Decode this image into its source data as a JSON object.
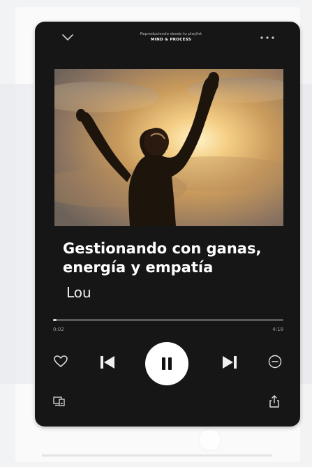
{
  "header": {
    "caption": "Reproduciendo desde tu playlist",
    "playlist": "MIND & PROCESS"
  },
  "track": {
    "title": "Gestionando con ganas, energía y empatía",
    "artist": "Lou"
  },
  "playback": {
    "elapsed": "0:02",
    "total": "4:18",
    "progress_fraction": 0.008,
    "state": "playing"
  },
  "icons": {
    "collapse": "chevron-down-icon",
    "menu": "more-icon",
    "like": "heart-icon",
    "previous": "skip-previous-icon",
    "play_state": "pause-icon",
    "next": "skip-next-icon",
    "hide": "minus-circle-icon",
    "devices": "devices-icon",
    "share": "share-icon"
  },
  "colors": {
    "player_bg": "#161616",
    "accent": "#ffffff",
    "track_bar": "#5a5a5a"
  }
}
